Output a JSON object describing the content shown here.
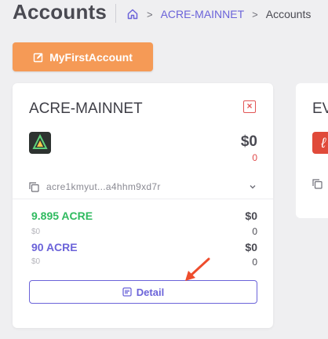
{
  "header": {
    "title": "Accounts",
    "breadcrumb": {
      "root": "ACRE-MAINNET",
      "current": "Accounts",
      "home_icon": "home-icon"
    }
  },
  "account_button": {
    "label": "MyFirstAccount",
    "icon": "edit-icon"
  },
  "card": {
    "chain": "ACRE-MAINNET",
    "total": "$0",
    "total_change": "0",
    "address": "acre1kmyut...a4hhm9xd7r",
    "assets": [
      {
        "name": "9.895 ACRE",
        "sub": "$0",
        "value": "$0",
        "value_sub": "0",
        "color": "#2fba5f"
      },
      {
        "name": "90 ACRE",
        "sub": "$0",
        "value": "$0",
        "value_sub": "0",
        "color": "#6b63d9"
      }
    ],
    "detail_label": "Detail"
  },
  "card2": {
    "chain": "EV"
  },
  "colors": {
    "accent": "#6b63d9",
    "orange": "#f59a56",
    "danger": "#e25555",
    "arrow": "#ee4d2d"
  }
}
